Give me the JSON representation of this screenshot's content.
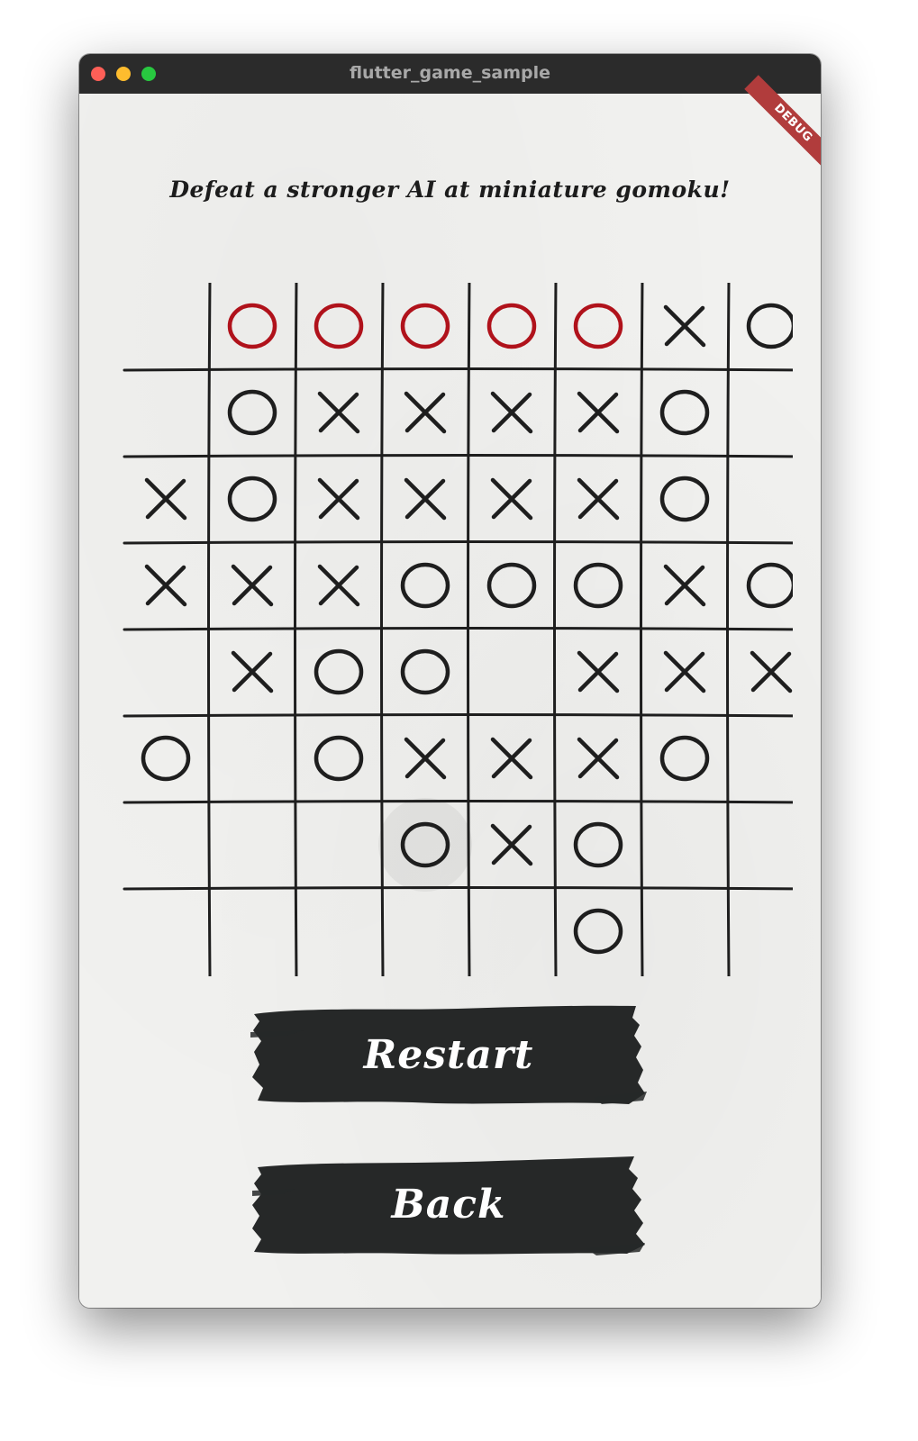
{
  "window": {
    "title": "flutter_game_sample",
    "debug_banner": "DEBUG"
  },
  "game": {
    "headline": "Defeat a stronger AI at miniature gomoku!",
    "rows": 8,
    "cols": 8,
    "board": [
      [
        "",
        "o",
        "o",
        "o",
        "o",
        "o",
        "x",
        "o"
      ],
      [
        "",
        "o",
        "x",
        "x",
        "x",
        "x",
        "o",
        ""
      ],
      [
        "x",
        "o",
        "x",
        "x",
        "x",
        "x",
        "o",
        ""
      ],
      [
        "x",
        "x",
        "x",
        "o",
        "o",
        "o",
        "x",
        "o"
      ],
      [
        "",
        "x",
        "o",
        "o",
        "",
        "x",
        "x",
        "x"
      ],
      [
        "o",
        "",
        "o",
        "x",
        "x",
        "x",
        "o",
        ""
      ],
      [
        "",
        "",
        "",
        "o",
        "x",
        "o",
        "",
        ""
      ],
      [
        "",
        "",
        "",
        "",
        "",
        "o",
        "",
        ""
      ]
    ],
    "winning_cells": [
      [
        0,
        1
      ],
      [
        0,
        2
      ],
      [
        0,
        3
      ],
      [
        0,
        4
      ],
      [
        0,
        5
      ]
    ],
    "highlighted_cell": [
      6,
      3
    ],
    "colors": {
      "ink": "#1e1e1e",
      "win": "#b0121b",
      "paper": "#f1f1ef"
    }
  },
  "buttons": {
    "restart_label": "Restart",
    "back_label": "Back",
    "fill_color": "#262828"
  }
}
